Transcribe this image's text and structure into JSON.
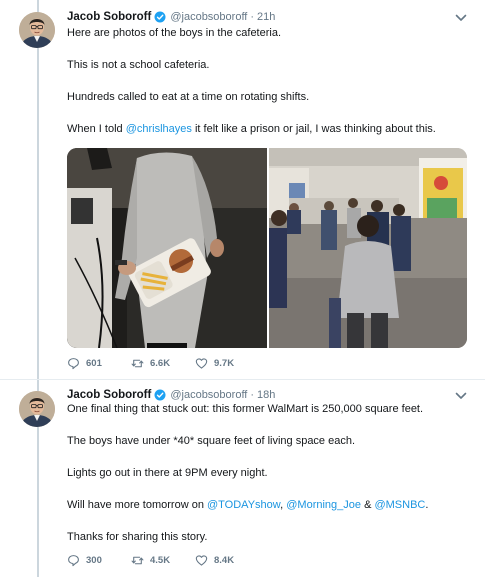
{
  "tweets": [
    {
      "author_name": "Jacob Soboroff",
      "handle": "@jacobsoboroff",
      "separator": "·",
      "time": "21h",
      "lines": [
        "Here are photos of the boys in the cafeteria.",
        "This is not a school cafeteria.",
        "Hundreds called to eat at a time on rotating shifts."
      ],
      "line4_before": "When I told ",
      "line4_mention": "@chrislhayes",
      "line4_after": " it felt like a prison or jail, I was thinking about this.",
      "replies": "601",
      "retweets": "6.6K",
      "likes": "9.7K"
    },
    {
      "author_name": "Jacob Soboroff",
      "handle": "@jacobsoboroff",
      "separator": "·",
      "time": "18h",
      "lines": [
        "One final thing that stuck out: this former WalMart is 250,000 square feet.",
        "The boys have under *40* square feet of living space each.",
        "Lights go out in there at 9PM every night."
      ],
      "line4_before": "Will have more tomorrow on ",
      "mention_1": "@TODAYshow",
      "comma": ", ",
      "mention_2": "@Morning_Joe",
      "amp": " & ",
      "mention_3": "@MSNBC",
      "period": ".",
      "line5": "Thanks for sharing this story.",
      "replies": "300",
      "retweets": "4.5K",
      "likes": "8.4K"
    }
  ],
  "colors": {
    "accent": "#1b95e0",
    "muted": "#657786",
    "thread": "#ccd6dd"
  },
  "icons": [
    "verified-badge-icon",
    "caret-down-icon",
    "reply-icon",
    "retweet-icon",
    "like-icon"
  ]
}
